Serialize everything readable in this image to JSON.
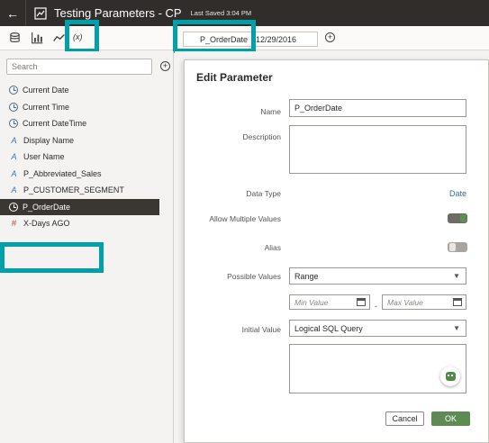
{
  "header": {
    "back_icon": "back-arrow-icon",
    "app_icon": "chart-icon",
    "title": "Testing Parameters - CP",
    "saved_status": "Last Saved 3:04 PM"
  },
  "toolbar": {
    "icons": [
      "data-icon",
      "visualizations-icon",
      "analytics-icon"
    ],
    "fx_label": "(x)",
    "filter_chip": {
      "name": "P_OrderDate",
      "value": "12/29/2016"
    },
    "add_icon": "plus-circle-icon"
  },
  "left_panel": {
    "search_placeholder": "Search",
    "items": [
      {
        "label": "Current Date",
        "icon": "clock-icon",
        "selected": false
      },
      {
        "label": "Current Time",
        "icon": "clock-icon",
        "selected": false
      },
      {
        "label": "Current DateTime",
        "icon": "clock-icon",
        "selected": false
      },
      {
        "label": "Display Name",
        "icon": "text-icon",
        "selected": false
      },
      {
        "label": "User Name",
        "icon": "text-icon",
        "selected": false
      },
      {
        "label": "P_Abbreviated_Sales",
        "icon": "text-icon",
        "selected": false
      },
      {
        "label": "P_CUSTOMER_SEGMENT",
        "icon": "text-icon",
        "selected": false
      },
      {
        "label": "P_OrderDate",
        "icon": "clock-icon",
        "selected": true
      },
      {
        "label": "X-Days AGO",
        "icon": "number-icon",
        "selected": false
      }
    ]
  },
  "dialog": {
    "title": "Edit Parameter",
    "name_label": "Name",
    "name_value": "P_OrderDate",
    "description_label": "Description",
    "description_value": "",
    "data_type_label": "Data Type",
    "data_type_value": "Date",
    "allow_multiple_label": "Allow Multiple Values",
    "allow_multiple_on": true,
    "alias_label": "Alias",
    "alias_on": false,
    "possible_values_label": "Possible Values",
    "possible_values_selected": "Range",
    "min_placeholder": "Min Value",
    "max_placeholder": "Max Value",
    "range_separator": "-",
    "initial_value_label": "Initial Value",
    "initial_value_selected": "Logical SQL Query",
    "initial_value_query": "",
    "cancel_label": "Cancel",
    "ok_label": "OK"
  },
  "colors": {
    "header_bg": "#312d2a",
    "highlight": "#00a0a8",
    "ok_button": "#5e8b53",
    "link_blue": "#2f6ea8",
    "selected_row": "#3a3632"
  }
}
